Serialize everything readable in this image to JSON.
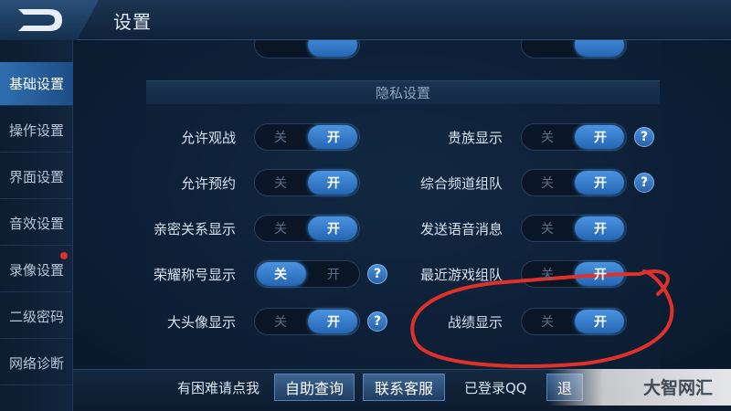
{
  "header": {
    "title": "设置"
  },
  "sidebar": {
    "items": [
      {
        "label": "基础设置",
        "active": true
      },
      {
        "label": "操作设置"
      },
      {
        "label": "界面设置"
      },
      {
        "label": "音效设置"
      },
      {
        "label": "录像设置",
        "badge": true
      },
      {
        "label": "二级密码"
      },
      {
        "label": "网络诊断"
      }
    ]
  },
  "toggle_labels": {
    "off": "关",
    "on": "开"
  },
  "section": {
    "title": "隐私设置"
  },
  "rows_left": [
    {
      "label": "允许观战",
      "state": "on",
      "help": false
    },
    {
      "label": "允许预约",
      "state": "on",
      "help": false
    },
    {
      "label": "亲密关系显示",
      "state": "on",
      "help": false
    },
    {
      "label": "荣耀称号显示",
      "state": "off",
      "help": true
    },
    {
      "label": "大头像显示",
      "state": "on",
      "help": true
    }
  ],
  "rows_right": [
    {
      "label": "贵族显示",
      "state": "on",
      "help": true
    },
    {
      "label": "综合频道组队",
      "state": "on",
      "help": true
    },
    {
      "label": "发送语音消息",
      "state": "on",
      "help": false
    },
    {
      "label": "最近游戏组队",
      "state": "on",
      "help": false
    },
    {
      "label": "战绩显示",
      "state": "on",
      "help": false
    }
  ],
  "help_glyph": "?",
  "bottom": {
    "help_text": "有困难请点我",
    "self_help_button": "自助查询",
    "contact_button": "联系客服",
    "login_status": "已登录QQ",
    "exit_button_partial": "退"
  },
  "watermark": "大智网汇",
  "colors": {
    "accent": "#2f6fb0",
    "toggle_on": "#3a86d6",
    "annotation": "#e0302a"
  },
  "icons": {
    "back": "back-arrow-icon",
    "help": "question-icon"
  }
}
